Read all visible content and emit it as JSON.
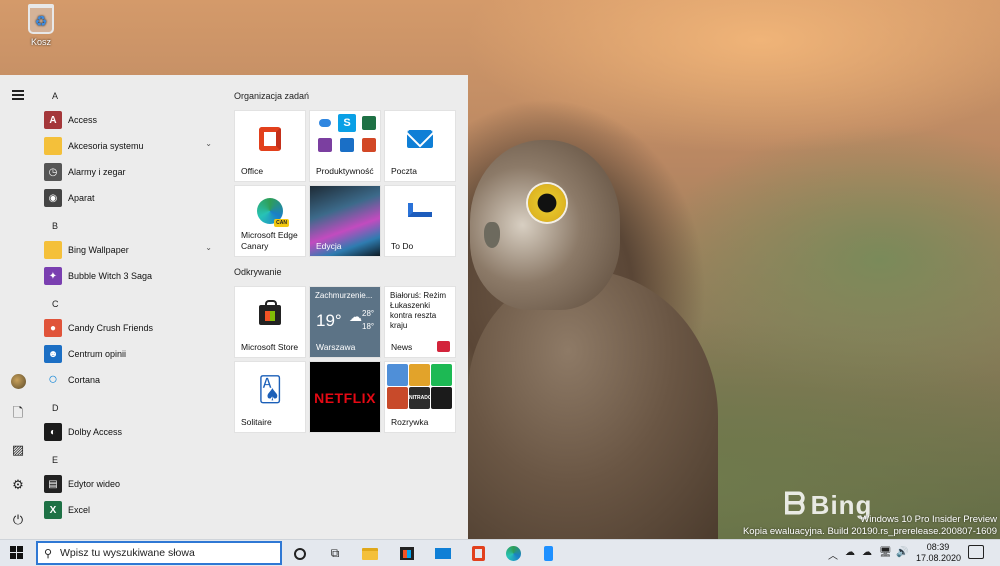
{
  "desktop": {
    "recycle_bin_label": "Kosz",
    "bing_label": "Bing",
    "watermark_line1": "Windows 10 Pro Insider Preview",
    "watermark_line2": "Kopia ewaluacyjna. Build 20190.rs_prerelease.200807-1609"
  },
  "start_menu": {
    "rail": {
      "icons": [
        "hamburger-icon",
        "avatar",
        "document-icon",
        "pictures-icon",
        "settings-icon",
        "power-icon"
      ]
    },
    "letters": [
      "A",
      "B",
      "C",
      "D",
      "E"
    ],
    "apps": [
      {
        "label": "Access",
        "icon": "access-icon",
        "color": "#a4373a",
        "glyph": "A"
      },
      {
        "label": "Akcesoria systemu",
        "icon": "folder-icon",
        "color": "#f4c03a",
        "glyph": "",
        "expandable": true
      },
      {
        "label": "Alarmy i zegar",
        "icon": "clock-icon",
        "color": "#555555",
        "glyph": "◷"
      },
      {
        "label": "Aparat",
        "icon": "camera-icon",
        "color": "#444444",
        "glyph": "◉"
      },
      {
        "label": "Bing Wallpaper",
        "icon": "folder-icon",
        "color": "#f4c03a",
        "glyph": "",
        "expandable": true
      },
      {
        "label": "Bubble Witch 3 Saga",
        "icon": "bubble-witch-icon",
        "color": "#7a3fb0",
        "glyph": "✦"
      },
      {
        "label": "Candy Crush Friends",
        "icon": "candy-crush-icon",
        "color": "#e0543a",
        "glyph": "●"
      },
      {
        "label": "Centrum opinii",
        "icon": "feedback-hub-icon",
        "color": "#1c6fc4",
        "glyph": "☻"
      },
      {
        "label": "Cortana",
        "icon": "cortana-icon",
        "color": "#ffffff",
        "glyph": "○"
      },
      {
        "label": "Dolby Access",
        "icon": "dolby-icon",
        "color": "#1b1b1b",
        "glyph": "◐"
      },
      {
        "label": "Edytor wideo",
        "icon": "video-editor-icon",
        "color": "#222222",
        "glyph": "▤"
      },
      {
        "label": "Excel",
        "icon": "excel-icon",
        "color": "#1e7145",
        "glyph": "X"
      }
    ],
    "group1_title": "Organizacja zadań",
    "group2_title": "Odkrywanie",
    "tiles": {
      "office": "Office",
      "productivity": "Produktywność",
      "mail": "Poczta",
      "edge_canary_line1": "Microsoft Edge",
      "edge_canary_line2": "Canary",
      "photos": "Edycja",
      "todo": "To Do",
      "store": "Microsoft Store",
      "weather_condition": "Zachmurzenie...",
      "weather_temp": "19°",
      "weather_high": "28°",
      "weather_low": "18°",
      "weather_city": "Warszawa",
      "news_headline": "Białoruś: Reżim Łukaszenki kontra reszta kraju",
      "news_label": "News",
      "solitaire": "Solitaire",
      "netflix": "NETFLIX",
      "games": "Rozrywka",
      "games_nitrado": "NITRADO"
    }
  },
  "taskbar": {
    "search_placeholder": "Wpisz tu wyszukiwane słowa",
    "time": "08:39",
    "date": "17.08.2020",
    "accent": "#2f78d4"
  }
}
